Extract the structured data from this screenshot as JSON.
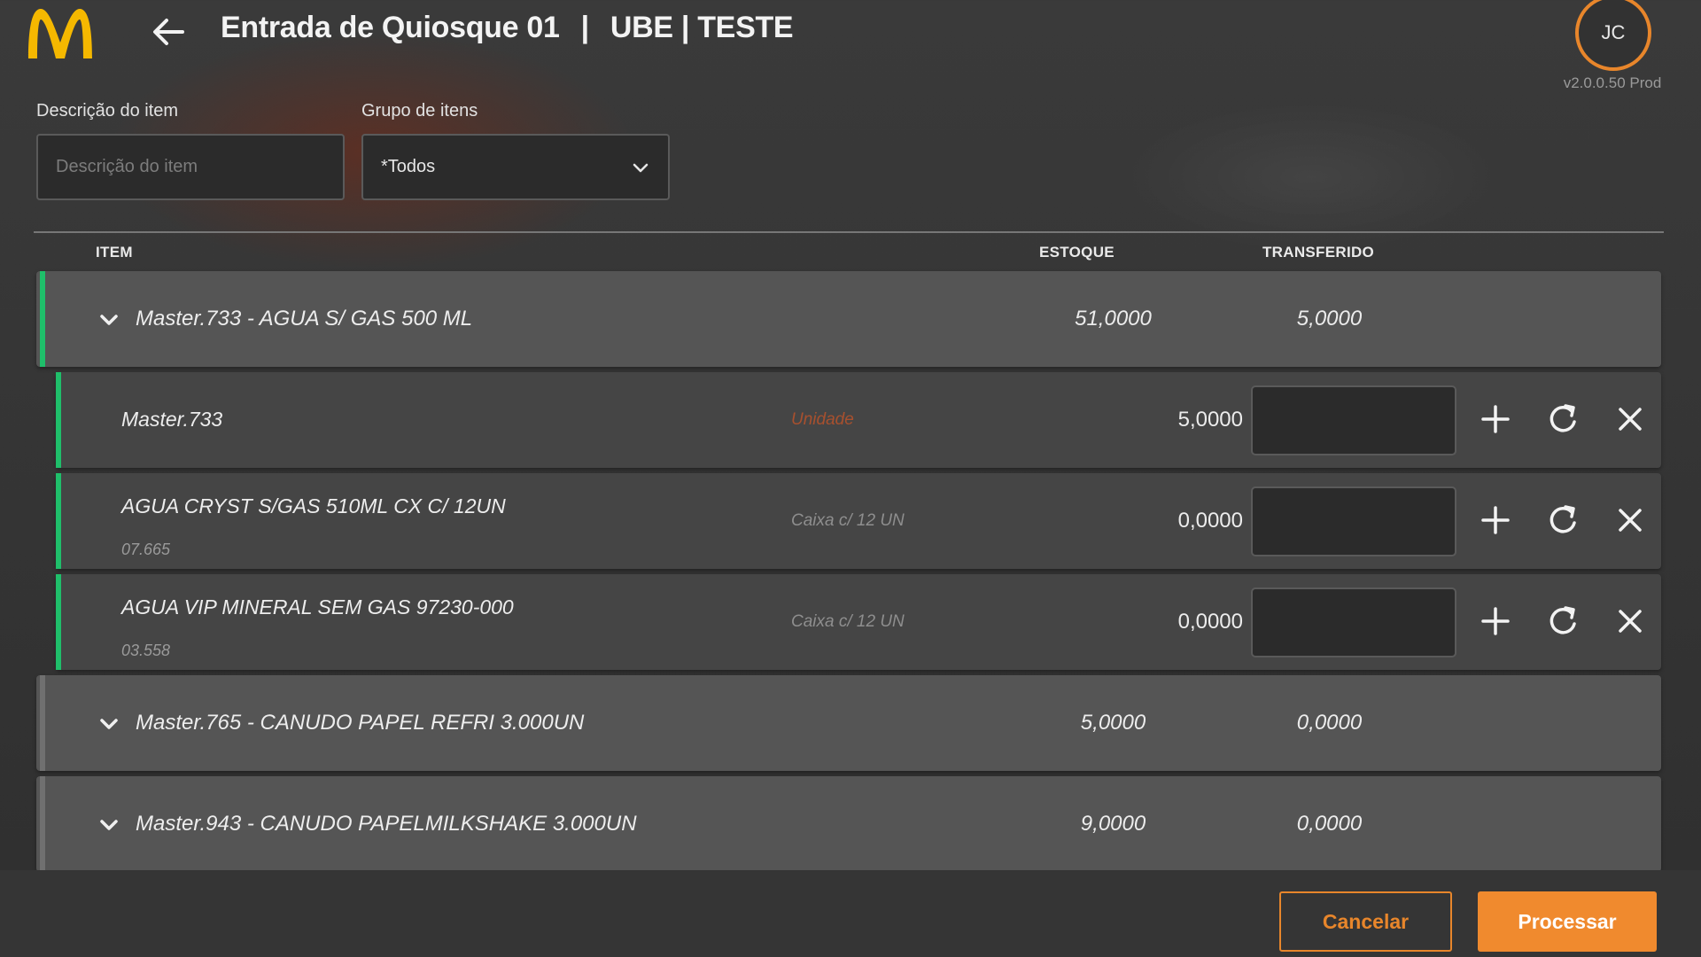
{
  "header": {
    "title_left": "Entrada de Quiosque 01",
    "separator": "|",
    "title_right": "UBE | TESTE",
    "avatar_initials": "JC",
    "version": "v2.0.0.50 Prod"
  },
  "filters": {
    "description": {
      "label": "Descrição do item",
      "placeholder": "Descrição do item",
      "value": ""
    },
    "group": {
      "label": "Grupo de itens",
      "selected": "*Todos"
    }
  },
  "table": {
    "headers": {
      "item": "ITEM",
      "estoque": "ESTOQUE",
      "transferido": "TRANSFERIDO"
    },
    "groups": [
      {
        "name": "Master.733 - AGUA S/ GAS 500 ML",
        "estoque": "51,0000",
        "transferido": "5,0000",
        "expanded": true,
        "bar_color": "#1fbf6a",
        "items": [
          {
            "name": "Master.733",
            "code": "",
            "unit": "Unidade",
            "quantity": "5,0000",
            "input_value": ""
          },
          {
            "name": "AGUA CRYST S/GAS 510ML CX  C/ 12UN",
            "code": "07.665",
            "unit": "Caixa c/ 12 UN",
            "quantity": "0,0000",
            "input_value": ""
          },
          {
            "name": "AGUA VIP MINERAL SEM GAS   97230-000",
            "code": "03.558",
            "unit": "Caixa c/ 12 UN",
            "quantity": "0,0000",
            "input_value": ""
          }
        ]
      },
      {
        "name": "Master.765 - CANUDO PAPEL REFRI 3.000UN",
        "estoque": "5,0000",
        "transferido": "0,0000",
        "expanded": false,
        "bar_color": "#707070"
      },
      {
        "name": "Master.943 - CANUDO PAPELMILKSHAKE 3.000UN",
        "estoque": "9,0000",
        "transferido": "0,0000",
        "expanded": false,
        "bar_color": "#707070"
      }
    ]
  },
  "footer": {
    "cancel_label": "Cancelar",
    "process_label": "Processar"
  },
  "colors": {
    "accent": "#f08a2e",
    "success_bar": "#1fbf6a",
    "unit_warning": "#a8502e"
  },
  "icons": {
    "logo": "mcdonalds-arches-logo",
    "back": "arrow-left-icon",
    "dropdown": "chevron-down-icon",
    "add": "plus-icon",
    "reset": "refresh-icon",
    "remove": "close-icon"
  }
}
